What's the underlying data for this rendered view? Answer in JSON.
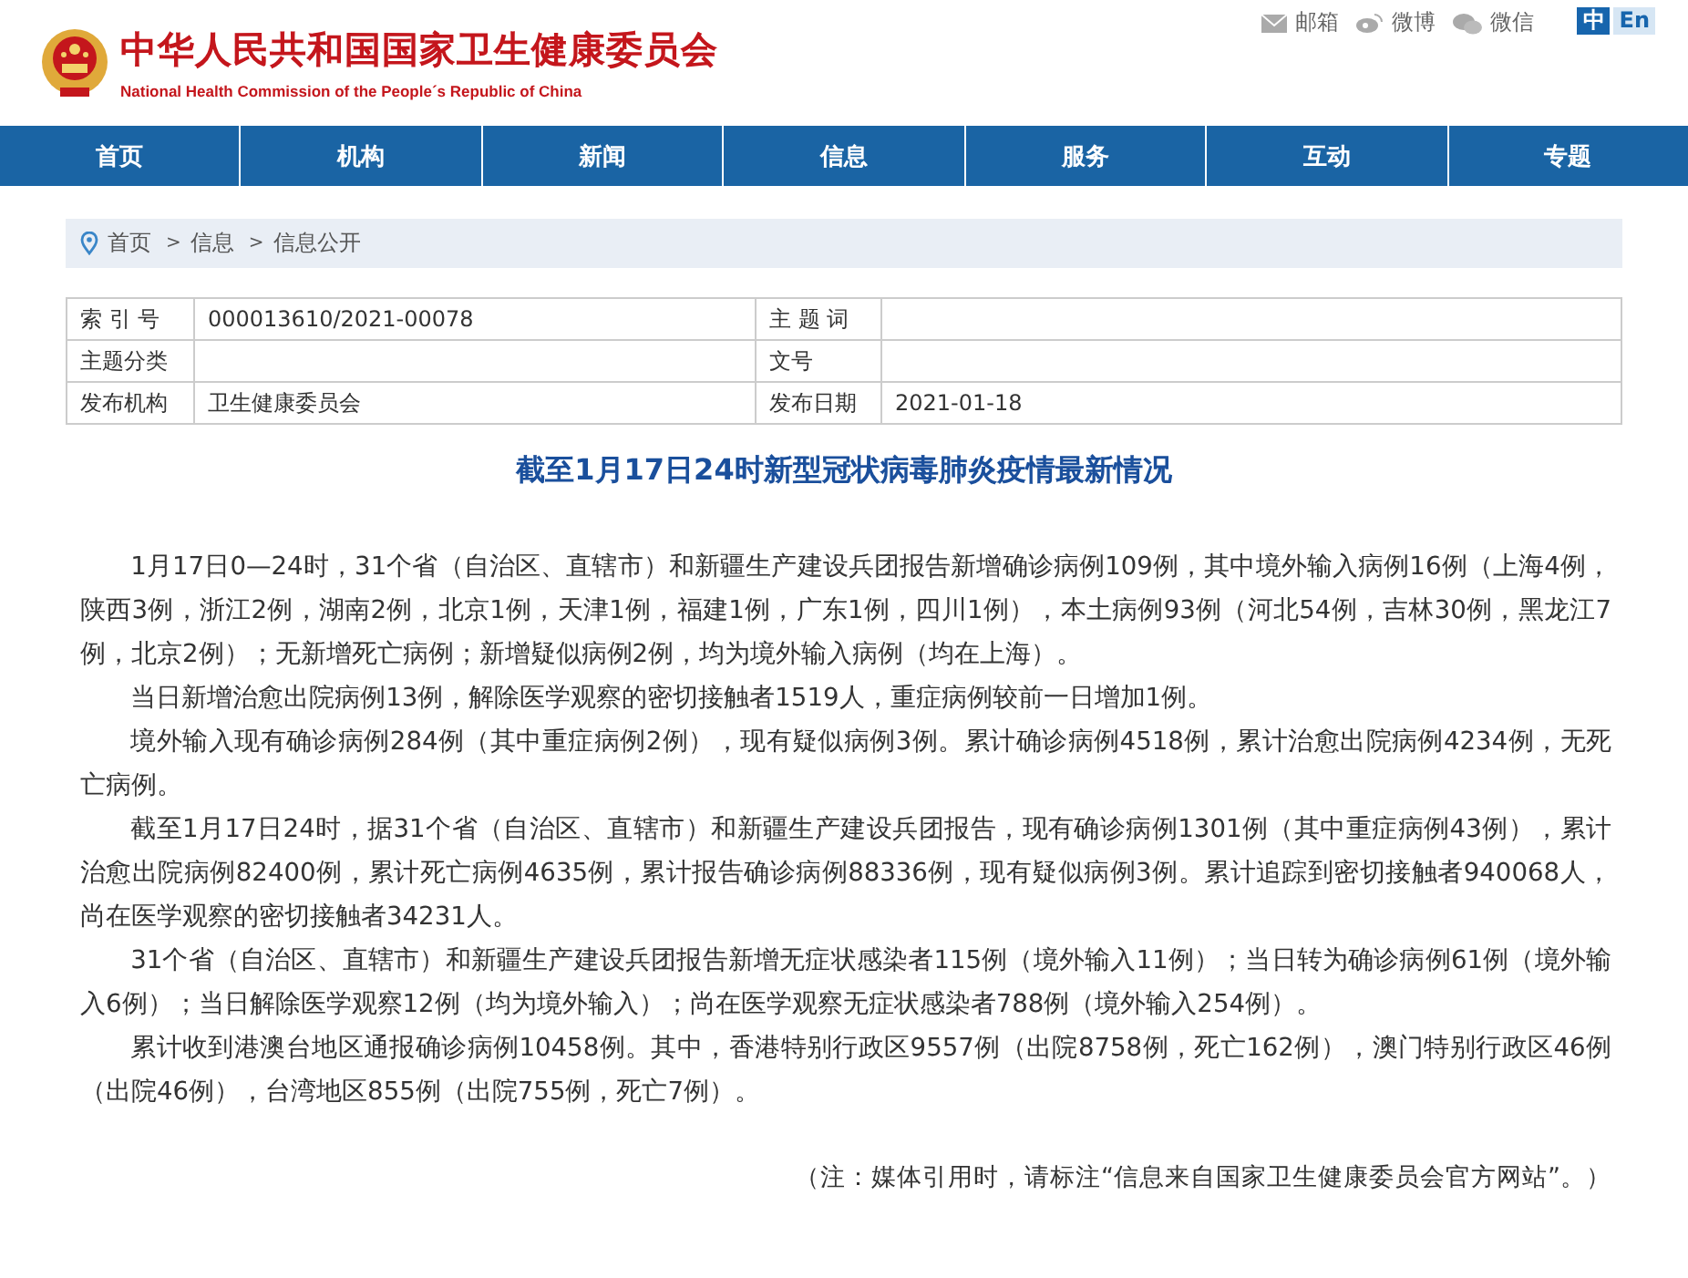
{
  "header": {
    "title": "中华人民共和国国家卫生健康委员会",
    "subtitle": "National Health Commission of the People´s Republic of China",
    "links": [
      {
        "kind": "mail",
        "label": "邮箱"
      },
      {
        "kind": "eye",
        "label": "微博"
      },
      {
        "kind": "chat",
        "label": "微信"
      }
    ],
    "languages": [
      {
        "label": "中",
        "selected": true
      },
      {
        "label": "En",
        "selected": false
      }
    ]
  },
  "nav": [
    {
      "label": "首页"
    },
    {
      "label": "机构"
    },
    {
      "label": "新闻"
    },
    {
      "label": "信息"
    },
    {
      "label": "服务"
    },
    {
      "label": "互动"
    },
    {
      "label": "专题"
    }
  ],
  "breadcrumb": {
    "separator": ">",
    "items": [
      {
        "label": "首页"
      },
      {
        "label": "信息"
      },
      {
        "label": "信息公开"
      }
    ]
  },
  "meta_table": {
    "rows": [
      [
        {
          "label": "索 引 号",
          "value": "000013610/2021-00078"
        },
        {
          "label": "主 题 词"
        }
      ],
      [
        {
          "label": "主题分类"
        },
        {
          "label": "文号"
        }
      ],
      [
        {
          "label": "发布机构",
          "value": "卫生健康委员会"
        },
        {
          "label": "发布日期",
          "value": "2021-01-18"
        }
      ]
    ]
  },
  "article": {
    "title": "截至1月17日24时新型冠状病毒肺炎疫情最新情况",
    "paragraphs": [
      "1月17日0—24时，31个省（自治区、直辖市）和新疆生产建设兵团报告新增确诊病例109例，其中境外输入病例16例（上海4例，陕西3例，浙江2例，湖南2例，北京1例，天津1例，福建1例，广东1例，四川1例），本土病例93例（河北54例，吉林30例，黑龙江7例，北京2例）；无新增死亡病例；新增疑似病例2例，均为境外输入病例（均在上海）。",
      "当日新增治愈出院病例13例，解除医学观察的密切接触者1519人，重症病例较前一日增加1例。",
      "境外输入现有确诊病例284例（其中重症病例2例），现有疑似病例3例。累计确诊病例4518例，累计治愈出院病例4234例，无死亡病例。",
      "截至1月17日24时，据31个省（自治区、直辖市）和新疆生产建设兵团报告，现有确诊病例1301例（其中重症病例43例），累计治愈出院病例82400例，累计死亡病例4635例，累计报告确诊病例88336例，现有疑似病例3例。累计追踪到密切接触者940068人，尚在医学观察的密切接触者34231人。",
      "31个省（自治区、直辖市）和新疆生产建设兵团报告新增无症状感染者115例（境外输入11例）；当日转为确诊病例61例（境外输入6例）；当日解除医学观察12例（均为境外输入）；尚在医学观察无症状感染者788例（境外输入254例）。",
      "累计收到港澳台地区通报确诊病例10458例。其中，香港特别行政区9557例（出院8758例，死亡162例），澳门特别行政区46例（出院46例），台湾地区855例（出院755例，死亡7例）。"
    ],
    "note": "（注：媒体引用时，请标注“信息来自国家卫生健康委员会官方网站”。）"
  }
}
